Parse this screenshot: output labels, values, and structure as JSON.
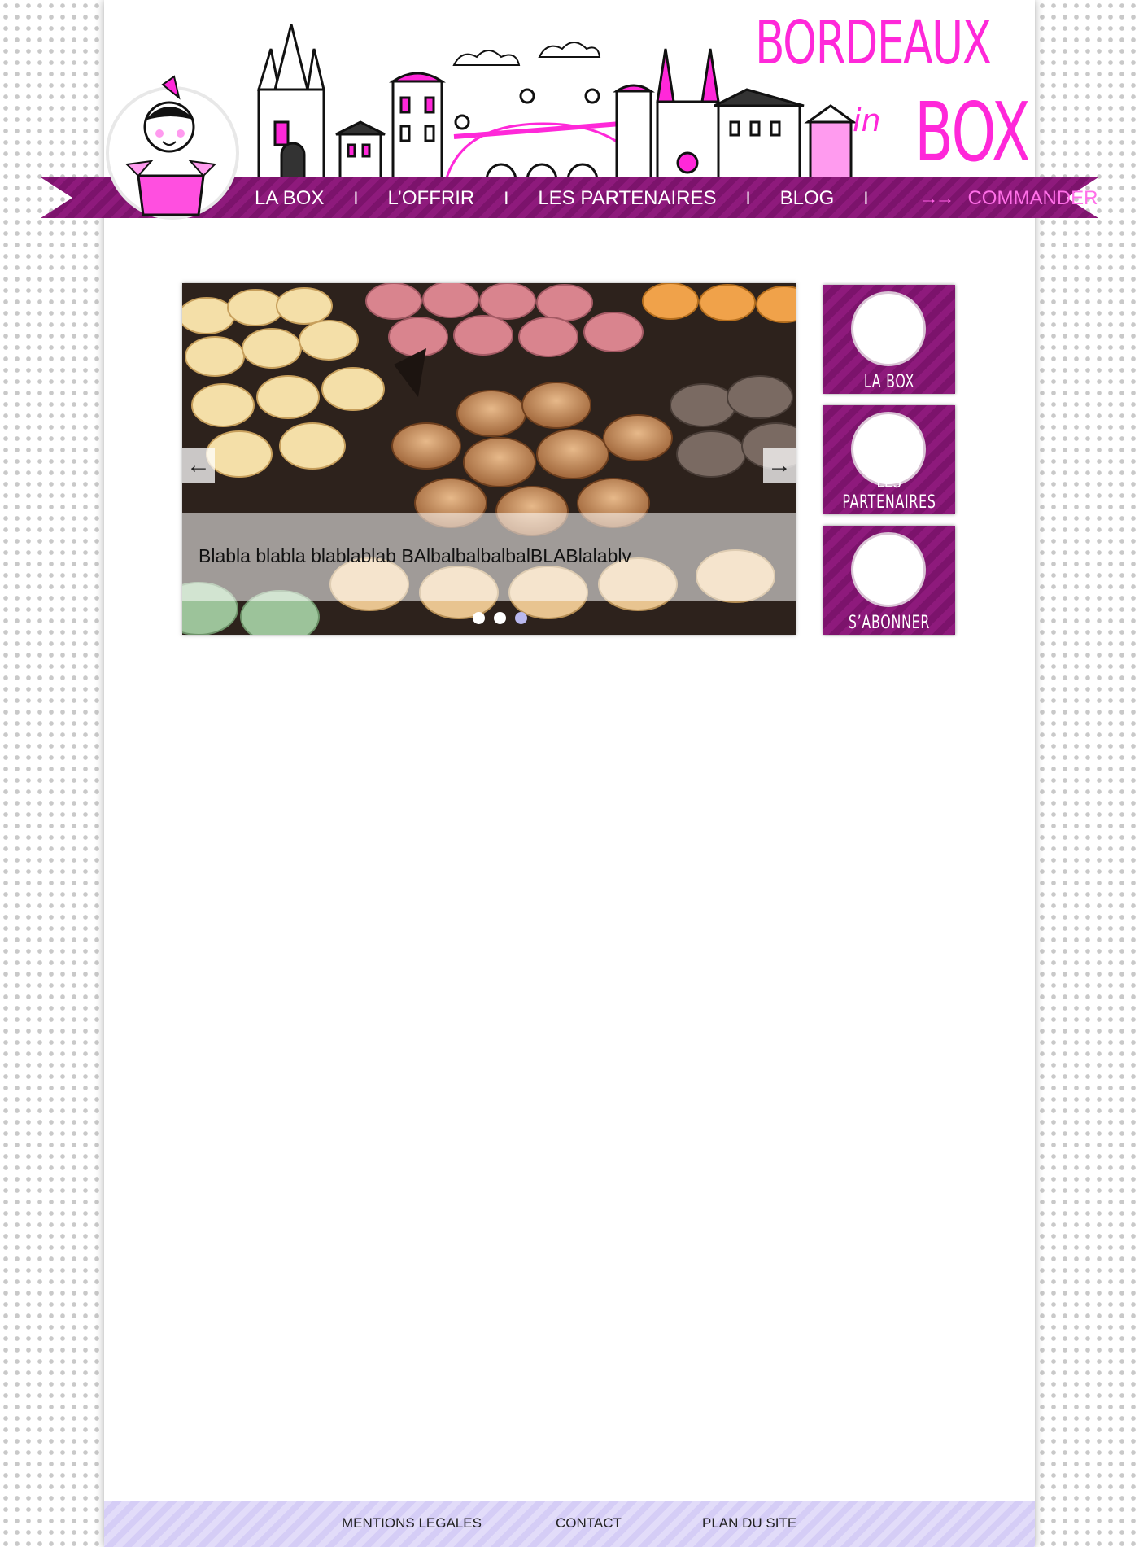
{
  "brand": {
    "line1": "BORDEAUX",
    "line2": "in",
    "line3": "BOX",
    "accent_color": "#ff28d9",
    "ribbon_color": "#8e1a7c"
  },
  "nav": {
    "items": [
      "LA BOX",
      "L’OFFRIR",
      "LES PARTENAIRES",
      "BLOG"
    ],
    "separator": "I",
    "arrow": "→→",
    "cta": "COMMANDER"
  },
  "slider": {
    "caption": "Blabla blabla blablablab BAlbalbalbalbalBLABlalablv",
    "prev_icon": "←",
    "next_icon": "→",
    "dots": 3,
    "active_dot": 3
  },
  "tiles": [
    {
      "label": "LA BOX",
      "icon": "girl-gift-icon"
    },
    {
      "label": "LES PARTENAIRES",
      "icon": "partners-icon"
    },
    {
      "label": "S’ABONNER",
      "icon": "subscribe-icon"
    }
  ],
  "footer": {
    "links": [
      "MENTIONS LEGALES",
      "CONTACT",
      "PLAN DU SITE"
    ],
    "color": "#e2dcf9"
  }
}
